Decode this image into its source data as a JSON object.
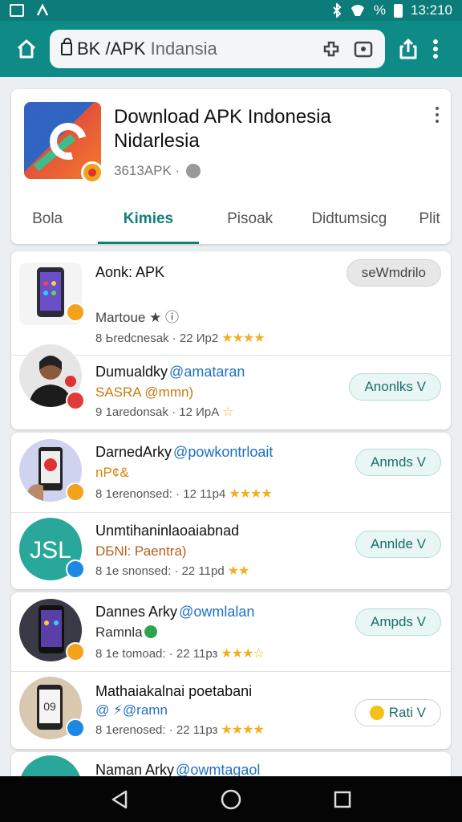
{
  "status_bar": {
    "time": "13:210",
    "battery_label": "%"
  },
  "browser": {
    "url_host": "BK /APK",
    "url_rest": "Indansia"
  },
  "app": {
    "title": "Download APK Indonesia Nidarlesia",
    "meta": "3613APK ·",
    "tabs": [
      "Bola",
      "Kimies",
      "Pisoak",
      "Didtumsicg",
      "Plit"
    ],
    "active_tab": "Kimies"
  },
  "colors": {
    "toolbar": "#0e8a87",
    "accent": "#11807d",
    "star": "#f2b01e",
    "handle": "#1f6fc5"
  },
  "groups": [
    {
      "rows": [
        {
          "title": "Aonk: APK",
          "handle": "",
          "sub": "Martoue ★ ⓘ",
          "sub_color": "#444",
          "meta": "8 Ьredcnesak · 22 Ир2",
          "stars": "★★★★",
          "button": "sеWmdrilo",
          "avatar": "phone-icon",
          "badge_color": "#f2a31b"
        },
        {
          "title": "Dumualdky",
          "handle": "@amatarаn",
          "sub": "SASRA @mmn)",
          "sub_color": "#c9780c",
          "meta": "9 1aredonsak · 12 ИрА",
          "stars": "☆",
          "button": "Anonlks V",
          "avatar": "person-avatar",
          "badge_color": "#e23a3a"
        }
      ]
    },
    {
      "rows": [
        {
          "title": "DarnedArky",
          "handle": "@powkontrloait",
          "sub": "nP¢&",
          "sub_color": "#d4870d",
          "meta": "8 1erenonsed: · 12 11р4",
          "stars": "★★★★",
          "button": "Anmds V",
          "avatar": "phone-hand-icon",
          "badge_color": "#f2a31b"
        },
        {
          "title": "Unmtihaninlaoaiabnad",
          "handle": "",
          "sub": "DБNl: Раеntra)",
          "sub_color": "#b3611b",
          "meta": "8 1e snonsed: · 22 11рd",
          "stars": "★★",
          "button": "Annlde V",
          "avatar": "jsl-logo",
          "badge_color": "#1e88e5"
        }
      ]
    },
    {
      "rows": [
        {
          "title": "Dannes Arky",
          "handle": "@owmlalan",
          "sub": "Ramnla",
          "sub_color": "#333",
          "meta": "8 1e tomoad: · 22 11рз",
          "stars": "★★★☆",
          "button": "Ampds V",
          "avatar": "phone-icon",
          "badge_color": "#f2a31b"
        },
        {
          "title": "Mathaiakalnai poetabani",
          "handle": "",
          "sub": "@ ⚡@ramn",
          "sub_color": "#1f6fc5",
          "meta": "8 1erenosed: · 22 11рз",
          "stars": "★★★★",
          "button": "Rati V",
          "avatar": "phone-hand-icon",
          "badge_color": "#1e88e5"
        }
      ]
    },
    {
      "rows": [
        {
          "title": "Naman Arky",
          "handle": "@owmtagaol",
          "sub": "",
          "sub_color": "#333",
          "meta": "",
          "stars": "",
          "button": "",
          "avatar": "phone-icon",
          "badge_color": "#f2a31b"
        }
      ]
    }
  ]
}
